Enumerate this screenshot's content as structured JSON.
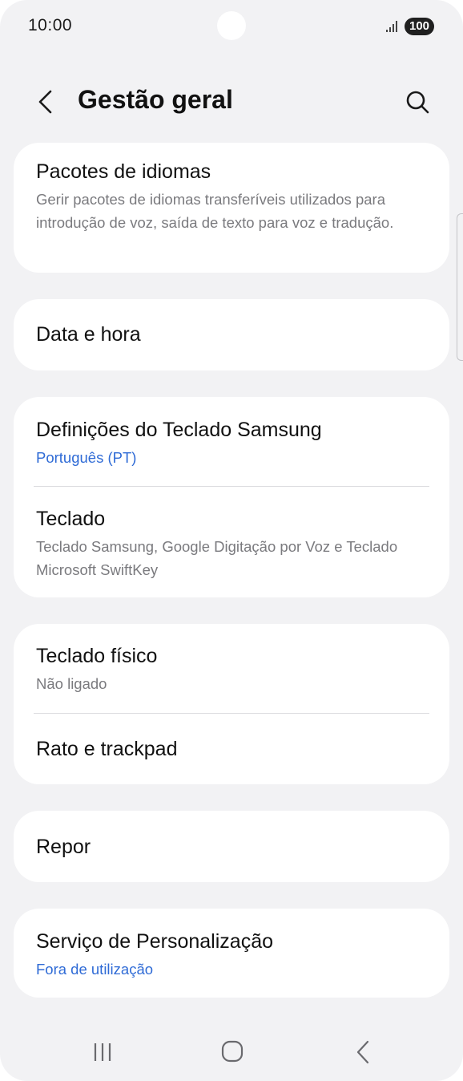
{
  "status_bar": {
    "time": "10:00",
    "battery": "100",
    "signal_icon": "signal-bars-icon"
  },
  "header": {
    "title": "Gestão geral",
    "back_icon": "chevron-left-icon",
    "search_icon": "search-icon"
  },
  "cards": [
    {
      "items": [
        {
          "title": "Pacotes de idiomas",
          "subtitle": "Gerir pacotes de idiomas transferíveis utilizados para introdução de voz, saída de texto para voz e tradução."
        }
      ]
    },
    {
      "items": [
        {
          "title": "Data e hora"
        }
      ]
    },
    {
      "items": [
        {
          "title": "Definições do Teclado Samsung",
          "subtitle": "Português (PT)"
        },
        {
          "title": "Teclado",
          "subtitle": "Teclado Samsung, Google Digitação por Voz e Teclado Microsoft SwiftKey"
        }
      ]
    },
    {
      "items": [
        {
          "title": "Teclado físico",
          "subtitle": "Não ligado"
        },
        {
          "title": "Rato e trackpad"
        }
      ]
    },
    {
      "items": [
        {
          "title": "Repor"
        }
      ]
    },
    {
      "items": [
        {
          "title": "Serviço de Personalização",
          "subtitle": "Fora de utilização"
        }
      ]
    }
  ],
  "nav_bar": {
    "recents_icon": "recents-icon",
    "home_icon": "home-icon",
    "back_icon": "back-icon"
  },
  "colors": {
    "background": "#f2f2f4",
    "card": "#ffffff",
    "accent_blue": "#2f6bd6",
    "secondary_text": "#7a7a7e"
  }
}
